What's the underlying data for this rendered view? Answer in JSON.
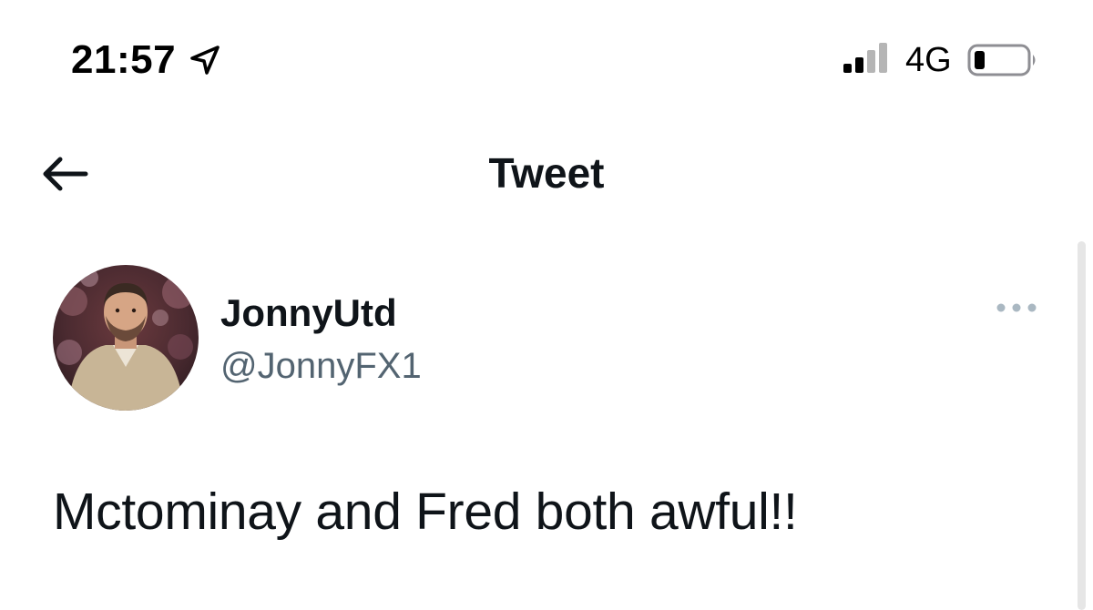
{
  "status_bar": {
    "time": "21:57",
    "network": "4G",
    "icons": [
      "location-arrow-icon",
      "signal-icon",
      "battery-icon"
    ],
    "battery_level": 0.15
  },
  "header": {
    "title": "Tweet",
    "back_icon": "back-arrow-icon"
  },
  "tweet": {
    "author": {
      "display_name": "JonnyUtd",
      "handle": "@JonnyFX1"
    },
    "more_icon": "more-options-icon",
    "text": "Mctominay and Fred both awful!!"
  },
  "colors": {
    "text_primary": "#0f1419",
    "text_secondary": "#536471",
    "background": "#ffffff",
    "more_dots": "#aab8c2"
  }
}
